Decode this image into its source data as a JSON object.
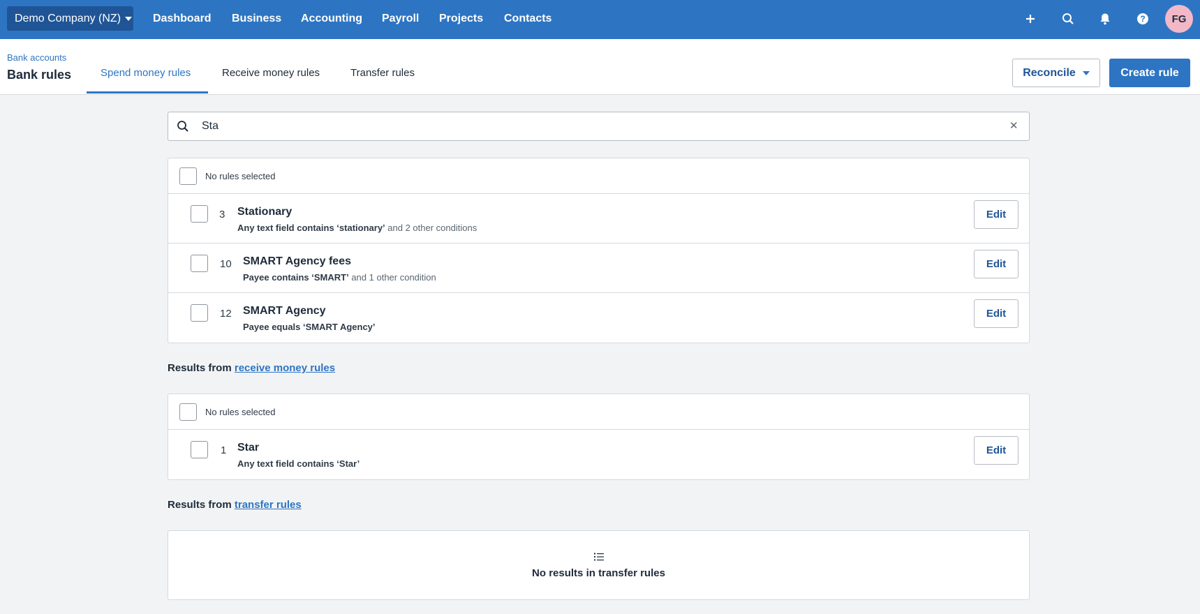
{
  "topnav": {
    "org_name": "Demo Company (NZ)",
    "items": [
      "Dashboard",
      "Business",
      "Accounting",
      "Payroll",
      "Projects",
      "Contacts"
    ],
    "avatar_initials": "FG",
    "icons": [
      "plus-icon",
      "search-icon",
      "bell-icon",
      "help-icon"
    ]
  },
  "subheader": {
    "breadcrumb": "Bank accounts",
    "title": "Bank rules",
    "tabs": [
      {
        "label": "Spend money rules",
        "active": true
      },
      {
        "label": "Receive money rules",
        "active": false
      },
      {
        "label": "Transfer rules",
        "active": false
      }
    ],
    "reconcile_label": "Reconcile",
    "create_label": "Create rule"
  },
  "search": {
    "value": "Sta"
  },
  "spend_rules": {
    "header": "No rules selected",
    "rows": [
      {
        "number": "3",
        "name": "Stationary",
        "desc_bold": "Any text field contains ‘stationary’",
        "desc_rest": " and 2 other conditions",
        "edit": "Edit"
      },
      {
        "number": "10",
        "name": "SMART Agency fees",
        "desc_bold": "Payee contains ‘SMART’",
        "desc_rest": " and 1 other condition",
        "edit": "Edit"
      },
      {
        "number": "12",
        "name": "SMART Agency",
        "desc_bold": "Payee equals ‘SMART Agency’",
        "desc_rest": "",
        "edit": "Edit"
      }
    ]
  },
  "receive_section": {
    "prefix": "Results from ",
    "link": "receive money rules"
  },
  "receive_rules": {
    "header": "No rules selected",
    "rows": [
      {
        "number": "1",
        "name": "Star",
        "desc_bold": "Any text field contains ‘Star’",
        "desc_rest": "",
        "edit": "Edit"
      }
    ]
  },
  "transfer_section": {
    "prefix": "Results from ",
    "link": "transfer rules"
  },
  "transfer_empty": {
    "text": "No results in transfer rules"
  },
  "colors": {
    "primary": "#2d75c3",
    "nav_dark": "#1f5596",
    "avatar": "#f3b8c8",
    "page_bg": "#f2f3f4"
  }
}
